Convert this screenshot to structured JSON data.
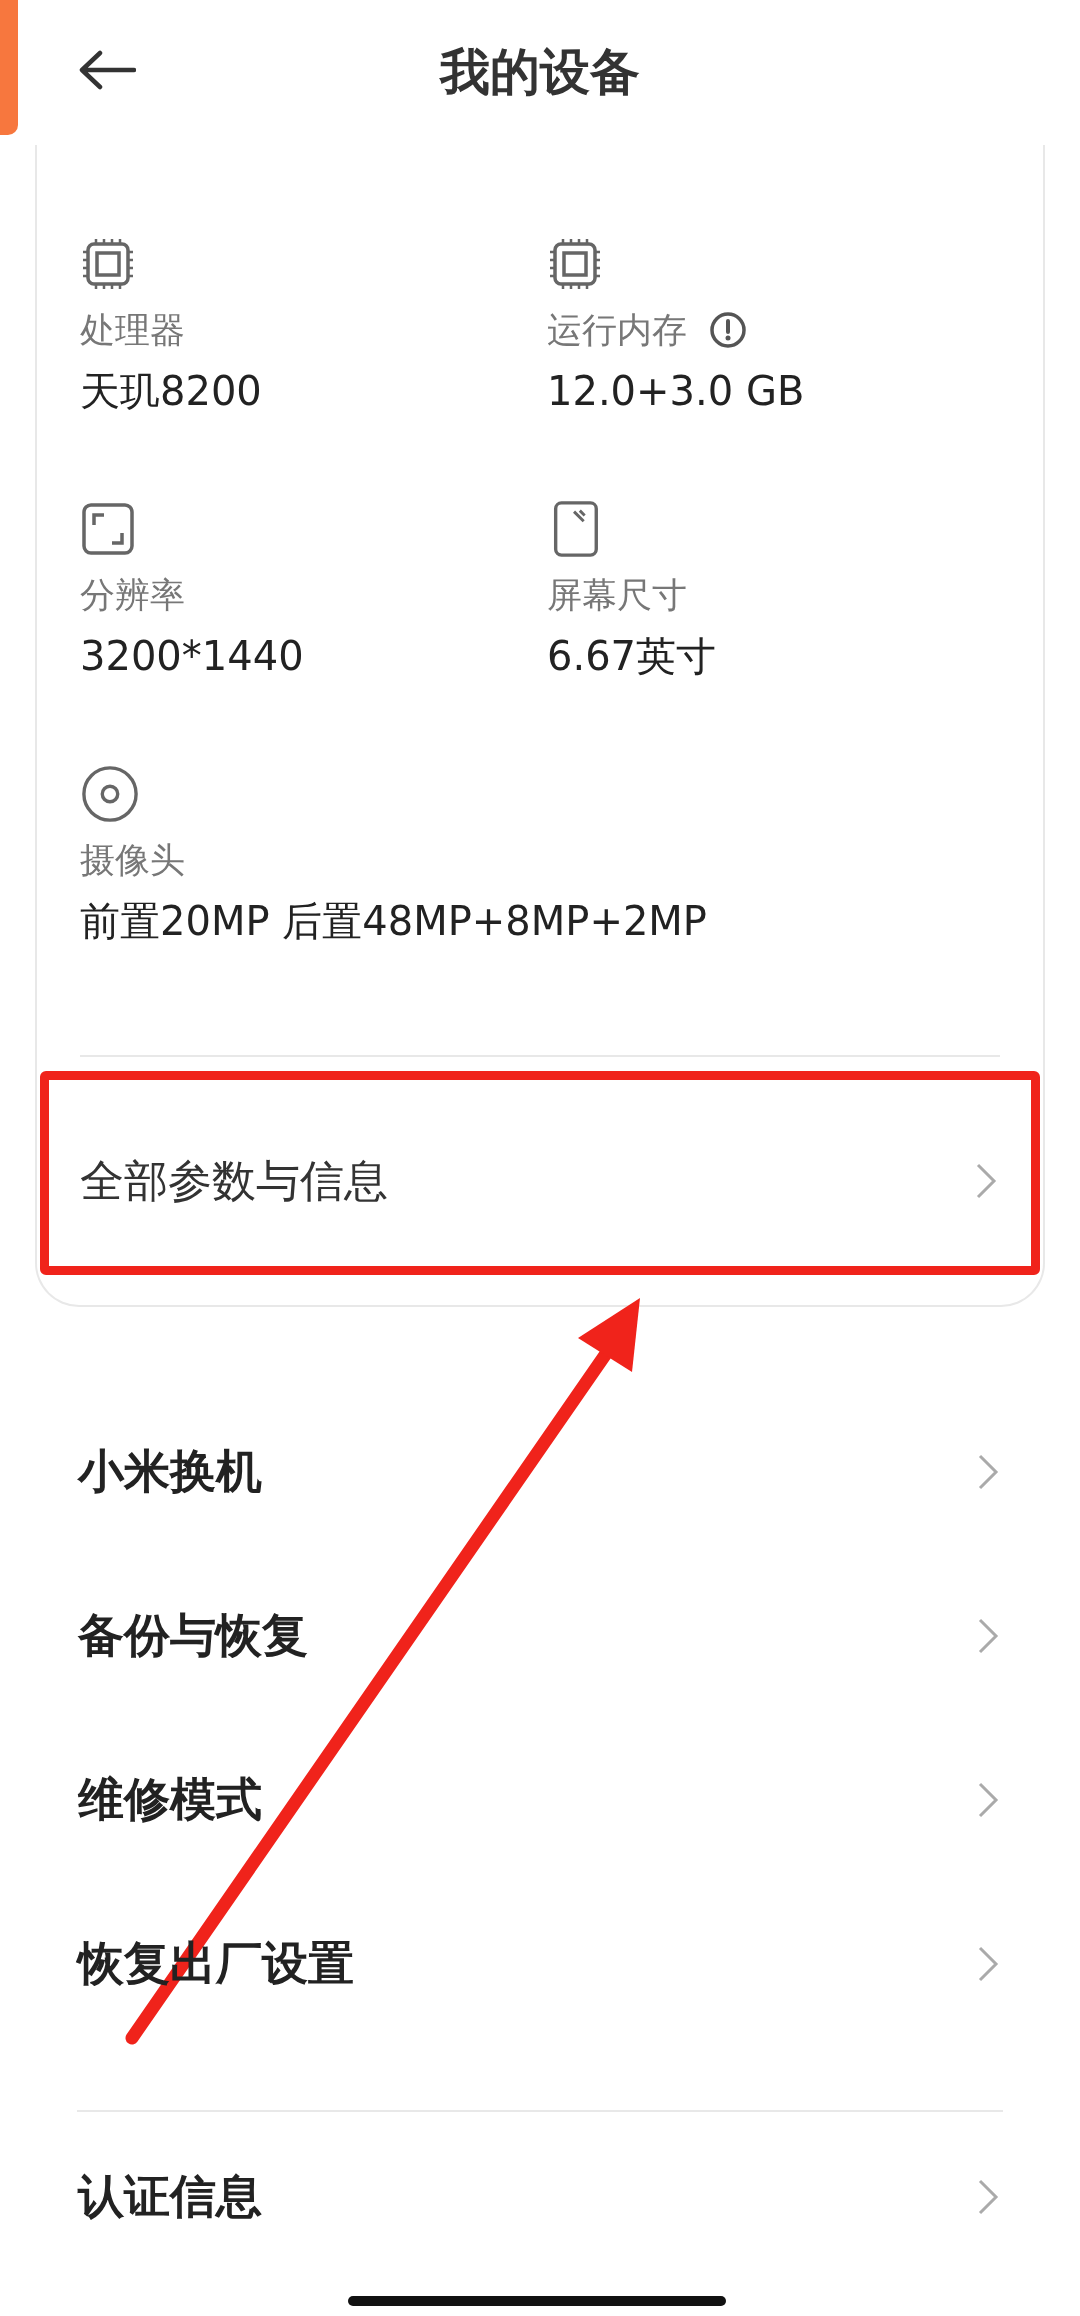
{
  "header": {
    "title": "我的设备"
  },
  "specs": [
    {
      "kind": "chip",
      "label": "处理器",
      "value": "天玑8200",
      "info": false
    },
    {
      "kind": "chip",
      "label": "运行内存",
      "value": "12.0+3.0 GB",
      "info": true
    },
    {
      "kind": "resolution",
      "label": "分辨率",
      "value": "3200*1440",
      "info": false
    },
    {
      "kind": "screen",
      "label": "屏幕尺寸",
      "value": "6.67英寸",
      "info": false
    },
    {
      "kind": "camera",
      "label": "摄像头",
      "value": "前置20MP 后置48MP+8MP+2MP",
      "info": false
    }
  ],
  "all_params": {
    "label": "全部参数与信息"
  },
  "menu": [
    {
      "label": "小米换机"
    },
    {
      "label": "备份与恢复"
    },
    {
      "label": "维修模式"
    },
    {
      "label": "恢复出厂设置"
    }
  ],
  "menu_after_divider": [
    {
      "label": "认证信息"
    }
  ]
}
